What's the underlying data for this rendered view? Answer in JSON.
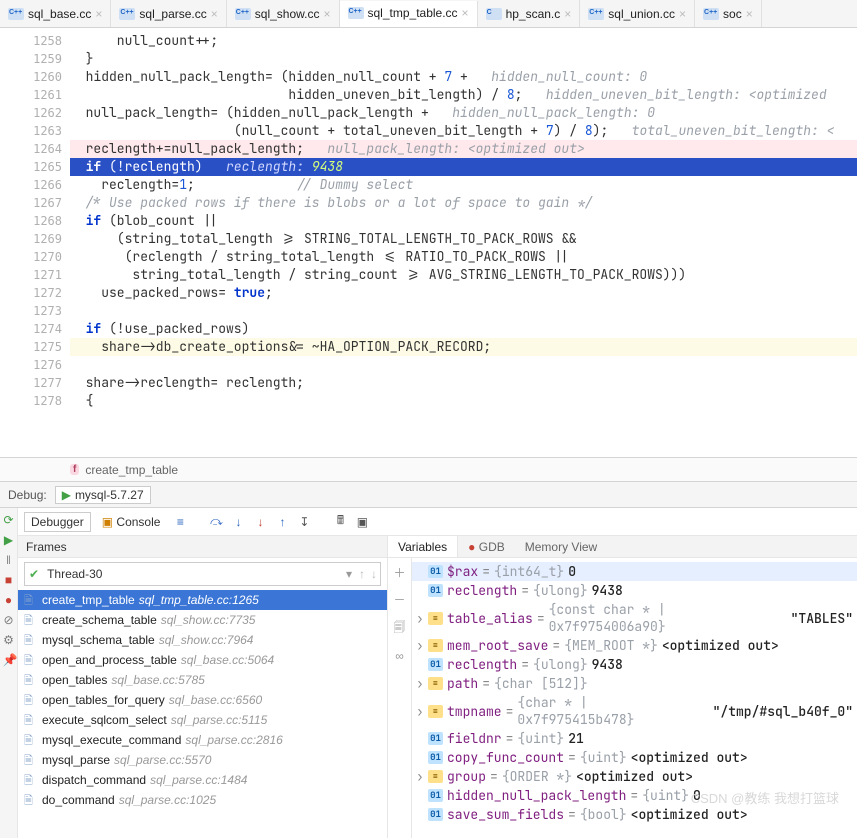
{
  "tabs": [
    {
      "label": "sql_base.cc",
      "kind": "cpp",
      "active": false
    },
    {
      "label": "sql_parse.cc",
      "kind": "cpp",
      "active": false
    },
    {
      "label": "sql_show.cc",
      "kind": "cpp",
      "active": false
    },
    {
      "label": "sql_tmp_table.cc",
      "kind": "cpp",
      "active": true
    },
    {
      "label": "hp_scan.c",
      "kind": "c",
      "active": false
    },
    {
      "label": "sql_union.cc",
      "kind": "cpp",
      "active": false
    },
    {
      "label": "soc",
      "kind": "cpp",
      "active": false
    }
  ],
  "gutter_start": 1258,
  "gutter_end": 1278,
  "bp_line": 1264,
  "cur_line": 1265,
  "step_line": 1275,
  "code": {
    "l1258": "      null_count++;",
    "l1259": "  }",
    "l1260_a": "  hidden_null_pack_length= (hidden_null_count + ",
    "l1260_n": "7",
    "l1260_b": " +",
    "l1260_h": "   hidden_null_count: 0",
    "l1261_a": "                            hidden_uneven_bit_length) / ",
    "l1261_n": "8",
    "l1261_b": ";",
    "l1261_h": "   hidden_uneven_bit_length: <optimized",
    "l1262_a": "  null_pack_length= (hidden_null_pack_length +",
    "l1262_h": "   hidden_null_pack_length: 0",
    "l1263_a": "                     (null_count + total_uneven_bit_length + ",
    "l1263_n1": "7",
    "l1263_b": ") / ",
    "l1263_n2": "8",
    "l1263_c": ");",
    "l1263_h": "   total_uneven_bit_length: <",
    "l1264_a": "  reclength+=null_pack_length;",
    "l1264_h": "   null_pack_length: <optimized out>",
    "l1265_if": "  if",
    "l1265_a": " (!reclength)",
    "l1265_h": "   reclength:",
    "l1265_v": " 9438",
    "l1266_a": "    reclength=",
    "l1266_n": "1",
    "l1266_b": ";",
    "l1266_c": "             // Dummy select",
    "l1267": "  /* Use packed rows if there is blobs or a lot of space to gain */",
    "l1268_if": "  if",
    "l1268_a": " (blob_count ||",
    "l1269": "      (string_total_length >= STRING_TOTAL_LENGTH_TO_PACK_ROWS &&",
    "l1270": "       (reclength / string_total_length <= RATIO_TO_PACK_ROWS ||",
    "l1271": "        string_total_length / string_count >= AVG_STRING_LENGTH_TO_PACK_ROWS)))",
    "l1272_a": "    use_packed_rows= ",
    "l1272_k": "true",
    "l1272_b": ";",
    "l1274_if": "  if",
    "l1274_a": " (!use_packed_rows)",
    "l1275": "    share->db_create_options&= ~HA_OPTION_PACK_RECORD;",
    "l1277": "  share->reclength= reclength;",
    "l1278": "  {"
  },
  "breadcrumb": {
    "badge": "f",
    "label": "create_tmp_table"
  },
  "debug": {
    "title": "Debug:",
    "run_cfg": "mysql-5.7.27",
    "tabs": {
      "debugger": "Debugger",
      "console": " Console"
    },
    "frames_title": "Frames",
    "thread": "Thread-30",
    "frames": [
      {
        "fn": "create_tmp_table",
        "loc": "sql_tmp_table.cc:1265",
        "sel": true
      },
      {
        "fn": "create_schema_table",
        "loc": "sql_show.cc:7735"
      },
      {
        "fn": "mysql_schema_table",
        "loc": "sql_show.cc:7964"
      },
      {
        "fn": "open_and_process_table",
        "loc": "sql_base.cc:5064"
      },
      {
        "fn": "open_tables",
        "loc": "sql_base.cc:5785"
      },
      {
        "fn": "open_tables_for_query",
        "loc": "sql_base.cc:6560"
      },
      {
        "fn": "execute_sqlcom_select",
        "loc": "sql_parse.cc:5115"
      },
      {
        "fn": "mysql_execute_command",
        "loc": "sql_parse.cc:2816"
      },
      {
        "fn": "mysql_parse",
        "loc": "sql_parse.cc:5570"
      },
      {
        "fn": "dispatch_command",
        "loc": "sql_parse.cc:1484"
      },
      {
        "fn": "do_command",
        "loc": "sql_parse.cc:1025"
      }
    ],
    "var_tabs": {
      "variables": "Variables",
      "gdb": "GDB",
      "memory": "Memory View"
    },
    "vars": [
      {
        "badge": "01",
        "name": "$rax",
        "type": "{int64_t}",
        "val": "0",
        "sel": true
      },
      {
        "badge": "01",
        "name": "reclength",
        "type": "{ulong}",
        "val": "9438"
      },
      {
        "badge": "eq",
        "name": "table_alias",
        "type": "{const char * | 0x7f9754006a90}",
        "val": "\"TABLES\"",
        "exp": true
      },
      {
        "badge": "eq",
        "name": "mem_root_save",
        "type": "{MEM_ROOT *}",
        "val": "<optimized out>",
        "exp": true
      },
      {
        "badge": "01",
        "name": "reclength",
        "type": "{ulong}",
        "val": "9438"
      },
      {
        "badge": "eq",
        "name": "path",
        "type": "{char [512]}",
        "val": "",
        "exp": true
      },
      {
        "badge": "eq",
        "name": "tmpname",
        "type": "{char * | 0x7f975415b478}",
        "val": "\"/tmp/#sql_b40f_0\"",
        "exp": true
      },
      {
        "badge": "01",
        "name": "fieldnr",
        "type": "{uint}",
        "val": "21"
      },
      {
        "badge": "01",
        "name": "copy_func_count",
        "type": "{uint}",
        "val": "<optimized out>"
      },
      {
        "badge": "eq",
        "name": "group",
        "type": "{ORDER *}",
        "val": "<optimized out>",
        "exp": true
      },
      {
        "badge": "01",
        "name": "hidden_null_pack_length",
        "type": "{uint}",
        "val": "0"
      },
      {
        "badge": "01",
        "name": "save_sum_fields",
        "type": "{bool}",
        "val": "<optimized out>"
      }
    ]
  },
  "watermark": "CSDN @教练   我想打篮球"
}
